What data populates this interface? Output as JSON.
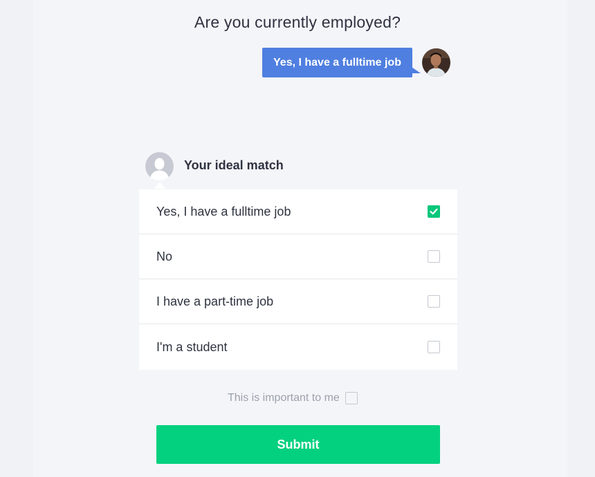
{
  "question": {
    "text": "Are you currently employed?"
  },
  "user_answer": {
    "text": "Yes, I have a fulltime job",
    "avatar_icon": "user-photo-avatar"
  },
  "ideal_match": {
    "title": "Your ideal match",
    "avatar_icon": "default-person-avatar",
    "options": [
      {
        "label": "Yes, I have a fulltime job",
        "checked": true
      },
      {
        "label": "No",
        "checked": false
      },
      {
        "label": "I have a part-time job",
        "checked": false
      },
      {
        "label": "I'm a student",
        "checked": false
      }
    ]
  },
  "importance": {
    "label": "This is important to me",
    "checked": false
  },
  "submit": {
    "label": "Submit"
  },
  "colors": {
    "answer_bubble": "#4f7fe0",
    "accent_green": "#04d17f",
    "checked_green": "#05c77a",
    "page_background": "#f4f5f9"
  }
}
